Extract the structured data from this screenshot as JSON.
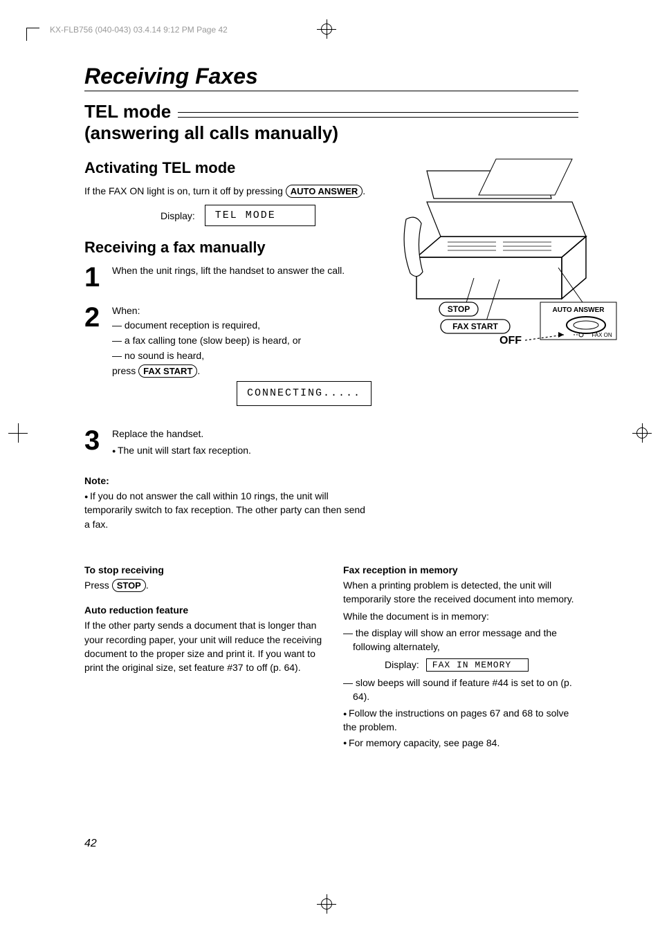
{
  "slug": "KX-FLB756 (040-043)  03.4.14  9:12 PM  Page 42",
  "section_title": "Receiving Faxes",
  "h2_line1": "TEL mode",
  "h2_line2": "(answering all calls manually)",
  "h3_activate": "Activating TEL mode",
  "activate_text": "If the FAX ON light is on, turn it off by pressing ",
  "btn_auto_answer": "AUTO ANSWER",
  "display_label": "Display:",
  "lcd_tel_mode": "TEL MODE",
  "h3_receive": "Receiving a fax manually",
  "steps": {
    "1": "When the unit rings, lift the handset to answer the call.",
    "2_lead": "When:",
    "2_a": "document reception is required,",
    "2_b": "a fax calling tone (slow beep) is heard, or",
    "2_c": "no sound is heard,",
    "2_press": "press ",
    "btn_fax_start": "FAX START",
    "lcd_connecting": "CONNECTING.....",
    "3_a": "Replace the handset.",
    "3_b": "The unit will start fax reception."
  },
  "note_h": "Note:",
  "note_body": "If you do not answer the call within 10 rings, the unit will temporarily switch to fax reception. The other party can then send a fax.",
  "stop_h": "To stop receiving",
  "stop_press": "Press ",
  "btn_stop": "STOP",
  "auto_red_h": "Auto reduction feature",
  "auto_red_body": "If the other party sends a document that is longer than your recording paper, your unit will reduce the receiving document to the proper size and print it. If you want to print the original size, set feature #37 to off (p. 64).",
  "mem_h": "Fax reception in memory",
  "mem_p1": "When a printing problem is detected, the unit will temporarily store the received document into memory.",
  "mem_p2": "While the document is in memory:",
  "mem_d1": "the display will show an error message and the following alternately,",
  "lcd_fax_mem": "FAX IN MEMORY",
  "mem_d2": "slow beeps will sound if feature #44 is set to on (p. 64).",
  "mem_b1": "Follow the instructions on pages 67 and 68 to solve the problem.",
  "mem_b2": "For memory capacity, see page 84.",
  "fig": {
    "stop": "STOP",
    "fax_start": "FAX START",
    "auto_answer": "AUTO ANSWER",
    "off": "OFF",
    "fax_on": "FAX ON"
  },
  "page_number": "42"
}
